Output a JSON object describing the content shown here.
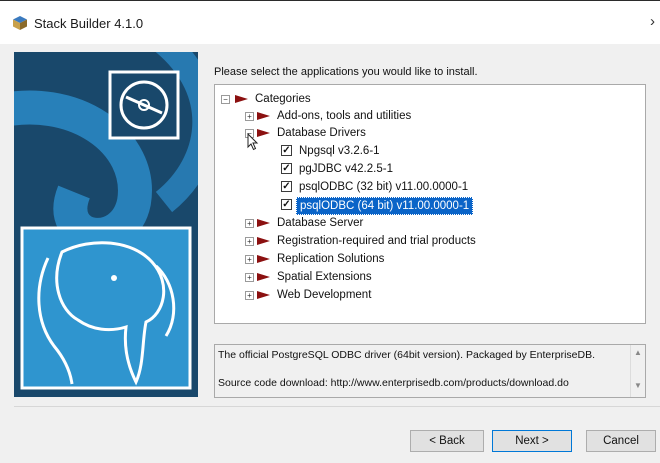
{
  "window": {
    "title": "Stack Builder 4.1.0"
  },
  "instruction": "Please select the applications you would like to install.",
  "tree": {
    "root_label": "Categories",
    "items": [
      {
        "label": "Add-ons, tools and utilities"
      },
      {
        "label": "Database Drivers"
      },
      {
        "label": "Npgsql v3.2.6-1",
        "checked": true
      },
      {
        "label": "pgJDBC v42.2.5-1",
        "checked": true
      },
      {
        "label": "psqlODBC (32 bit) v11.00.0000-1",
        "checked": true
      },
      {
        "label": "psqlODBC (64 bit) v11.00.0000-1",
        "checked": true,
        "selected": true
      },
      {
        "label": "Database Server"
      },
      {
        "label": "Registration-required and trial products"
      },
      {
        "label": "Replication Solutions"
      },
      {
        "label": "Spatial Extensions"
      },
      {
        "label": "Web Development"
      }
    ]
  },
  "description": {
    "line1": "The official PostgreSQL ODBC driver (64bit version). Packaged by EnterpriseDB.",
    "line2": "Source code download: http://www.enterprisedb.com/products/download.do"
  },
  "buttons": {
    "back": "< Back",
    "next": "Next >",
    "cancel": "Cancel"
  },
  "colors": {
    "banner": "#19486b",
    "arrow": "#8b1010",
    "selection": "#0a64c8"
  }
}
